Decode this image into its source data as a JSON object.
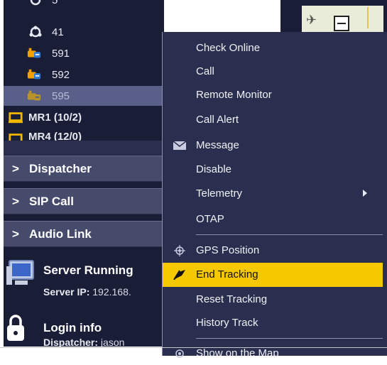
{
  "tree": {
    "partial_top": "5",
    "items": [
      {
        "label": "41",
        "icon": "user-group-icon"
      },
      {
        "label": "591",
        "icon": "radio-unit-icon"
      },
      {
        "label": "592",
        "icon": "radio-unit-icon"
      },
      {
        "label": "595",
        "icon": "radio-unit-icon",
        "selected": true
      },
      {
        "label": "MR1 (10/2)",
        "icon": "group-folder-icon"
      },
      {
        "label": "MR4 (12/0)",
        "icon": "group-folder-icon"
      }
    ]
  },
  "sections": [
    {
      "label": "Dispatcher"
    },
    {
      "label": "SIP Call"
    },
    {
      "label": "Audio Link"
    }
  ],
  "status": {
    "server_title": "Server Running",
    "server_ip_label": "Server IP:",
    "server_ip_value": "192.168.",
    "login_title": "Login info",
    "dispatcher_label": "Dispatcher:",
    "dispatcher_value": "jason"
  },
  "menu": {
    "items": [
      {
        "label": "Check Online"
      },
      {
        "label": "Call"
      },
      {
        "label": "Remote Monitor"
      },
      {
        "label": "Call Alert"
      },
      {
        "label": "Message",
        "icon": "envelope-icon"
      },
      {
        "label": "Disable"
      },
      {
        "label": "Telemetry",
        "submenu": true
      },
      {
        "label": "OTAP"
      },
      {
        "label": "GPS Position",
        "icon": "crosshair-icon"
      },
      {
        "label": "End Tracking",
        "icon": "flag-icon",
        "highlighted": true
      },
      {
        "label": "Reset Tracking"
      },
      {
        "label": "History Track"
      },
      {
        "label": "Show on the Map",
        "icon": "eye-icon"
      }
    ]
  },
  "colors": {
    "panel_bg": "#1a1d36",
    "menu_bg": "#2b2f4f",
    "highlight": "#f5c800",
    "icon_orange": "#f2a100",
    "icon_blue": "#2c7ad6"
  }
}
